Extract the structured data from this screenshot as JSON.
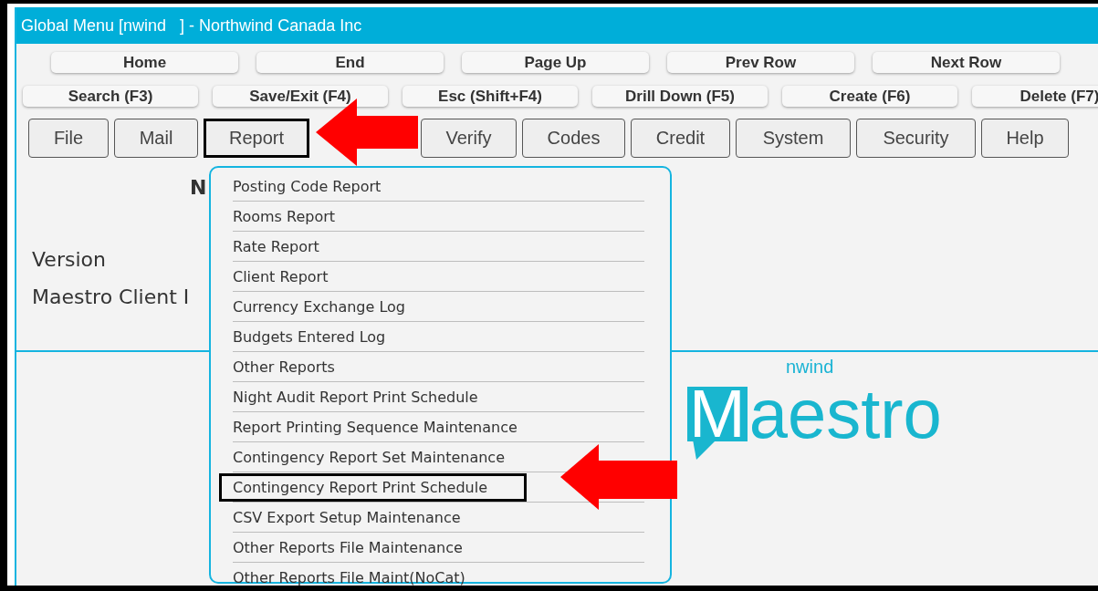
{
  "window": {
    "title": "Global Menu [nwind   ] - Northwind Canada Inc"
  },
  "nav_rows": [
    {
      "buttons": [
        "Home",
        "End",
        "Page Up",
        "Prev Row",
        "Next Row"
      ]
    },
    {
      "buttons": [
        "Search (F3)",
        "Save/Exit (F4)",
        "Esc (Shift+F4)",
        "Drill Down (F5)",
        "Create (F6)",
        "Delete (F7)"
      ]
    }
  ],
  "menu": [
    {
      "label": "File",
      "highlighted": false
    },
    {
      "label": "Mail",
      "highlighted": false
    },
    {
      "label": "Report",
      "highlighted": true
    },
    {
      "label": "Verify",
      "highlighted": false
    },
    {
      "label": "Codes",
      "highlighted": false
    },
    {
      "label": "Credit",
      "highlighted": false
    },
    {
      "label": "System",
      "highlighted": false
    },
    {
      "label": "Security",
      "highlighted": false
    },
    {
      "label": "Help",
      "highlighted": false
    }
  ],
  "info_panel": {
    "heading": "N",
    "fields": [
      "Version",
      "Maestro Client I"
    ]
  },
  "dropdown": {
    "items": [
      {
        "label": "Posting Code Report",
        "highlighted": false
      },
      {
        "label": "Rooms Report",
        "highlighted": false
      },
      {
        "label": "Rate Report",
        "highlighted": false
      },
      {
        "label": "Client Report",
        "highlighted": false
      },
      {
        "label": "Currency Exchange Log",
        "highlighted": false
      },
      {
        "label": "Budgets Entered Log",
        "highlighted": false
      },
      {
        "label": "Other Reports",
        "highlighted": false
      },
      {
        "label": "Night Audit Report Print Schedule",
        "highlighted": false
      },
      {
        "label": "Report Printing Sequence Maintenance",
        "highlighted": false
      },
      {
        "label": "Contingency Report Set Maintenance",
        "highlighted": false
      },
      {
        "label": "Contingency Report Print Schedule",
        "highlighted": true
      },
      {
        "label": "CSV Export Setup Maintenance",
        "highlighted": false
      },
      {
        "label": "Other Reports File Maintenance",
        "highlighted": false
      },
      {
        "label": "Other Reports File Maint(NoCat)",
        "highlighted": false
      }
    ]
  },
  "company_code": "nwind",
  "logo": {
    "boxed_letter": "M",
    "rest": "aestro"
  }
}
